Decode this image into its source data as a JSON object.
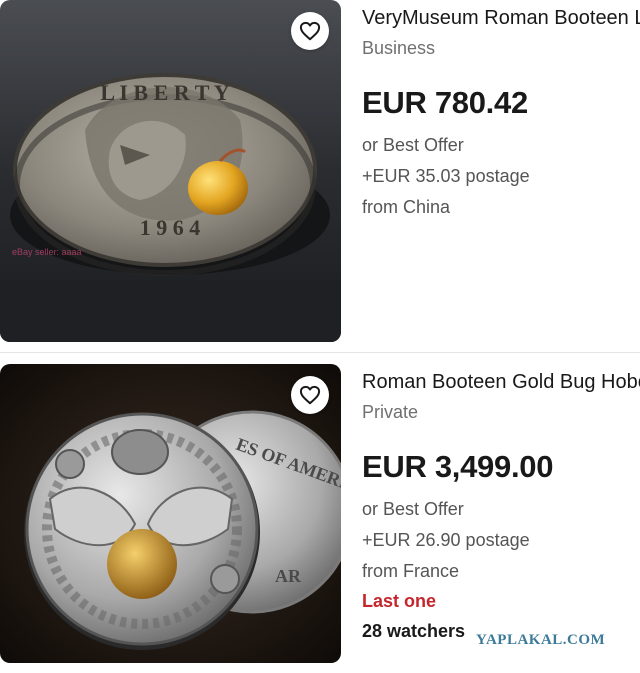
{
  "listings": [
    {
      "title": "VeryMuseum Roman Booteen Liberty Witch Coin",
      "seller_type": "Business",
      "price": "EUR 780.42",
      "offer": "or Best Offer",
      "postage": "+EUR 35.03 postage",
      "origin": "from China",
      "image": {
        "coin_text_top": "L I B E R T Y",
        "coin_year": "1 9 6 4",
        "overlay_text": "eBay seller: aaaa"
      }
    },
    {
      "title": "Roman Booteen Gold Bug Hobo Coin",
      "seller_type": "Private",
      "price": "EUR 3,499.00",
      "offer": "or Best Offer",
      "postage": "+EUR 26.90 postage",
      "origin": "from France",
      "urgency": "Last one",
      "watchers": "28 watchers",
      "image": {
        "coin_text": "ES OF AMERICA",
        "coin_text_bottom": "AR"
      }
    }
  ],
  "icons": {
    "watch": "heart-icon"
  },
  "watermark": "YAPLAKAL.COM",
  "colors": {
    "urgency": "#c5262d",
    "watermark": "#3d7a9a"
  }
}
